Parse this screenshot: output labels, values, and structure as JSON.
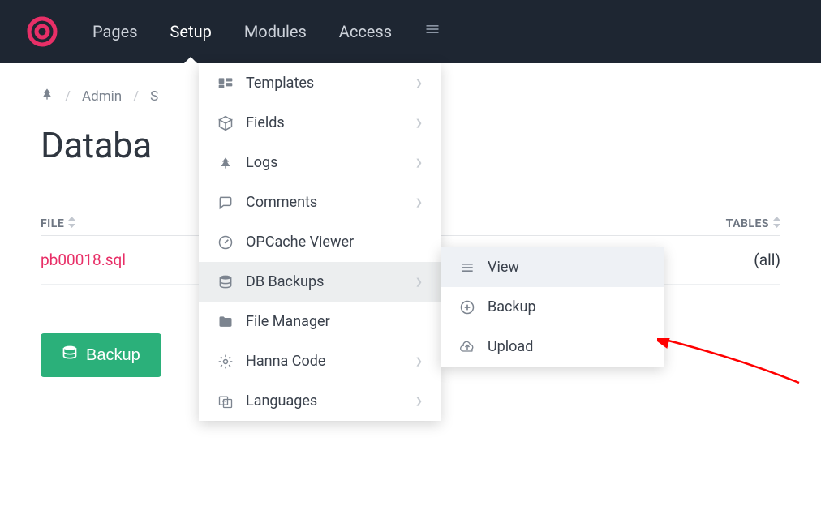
{
  "nav": {
    "items": [
      "Pages",
      "Setup",
      "Modules",
      "Access"
    ],
    "active_index": 1
  },
  "breadcrumb": {
    "items": [
      "Admin",
      "S"
    ]
  },
  "page_title": "Databa",
  "table": {
    "columns": {
      "file": "FILE",
      "tables": "TABLES"
    },
    "rows": [
      {
        "file": "pb00018.sql",
        "tables": "(all)"
      }
    ]
  },
  "backup_button": "Backup",
  "dropdown": {
    "items": [
      {
        "icon": "templates",
        "label": "Templates",
        "has_children": true
      },
      {
        "icon": "fields",
        "label": "Fields",
        "has_children": true
      },
      {
        "icon": "logs",
        "label": "Logs",
        "has_children": true
      },
      {
        "icon": "comments",
        "label": "Comments",
        "has_children": true
      },
      {
        "icon": "opcache",
        "label": "OPCache Viewer",
        "has_children": false
      },
      {
        "icon": "db",
        "label": "DB Backups",
        "has_children": true,
        "highlight": true
      },
      {
        "icon": "folder",
        "label": "File Manager",
        "has_children": false
      },
      {
        "icon": "gear",
        "label": "Hanna Code",
        "has_children": true
      },
      {
        "icon": "lang",
        "label": "Languages",
        "has_children": true
      }
    ]
  },
  "submenu": {
    "items": [
      {
        "icon": "list",
        "label": "View",
        "highlight": true
      },
      {
        "icon": "plus-circle",
        "label": "Backup"
      },
      {
        "icon": "cloud-up",
        "label": "Upload"
      }
    ]
  }
}
